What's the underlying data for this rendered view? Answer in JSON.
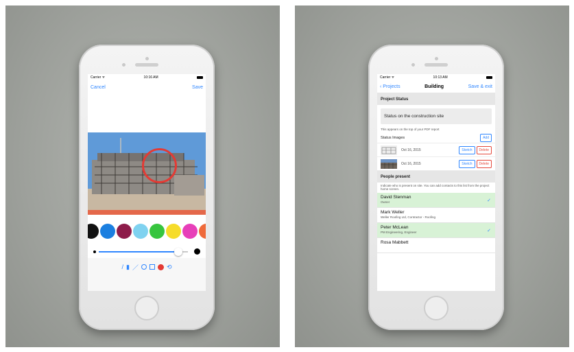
{
  "left": {
    "status_bar": {
      "carrier": "Carrier ᯤ",
      "time": "10:16 AM"
    },
    "nav": {
      "cancel": "Cancel",
      "save": "Save"
    },
    "palette_colors": [
      "#111111",
      "#1b7fe0",
      "#8e1c4a",
      "#7fd2f0",
      "#37c53f",
      "#f6dc2a",
      "#e73fb9",
      "#ef6a3a"
    ],
    "toolbar_icons": [
      "brush-icon",
      "marker-icon",
      "line-icon",
      "circle-icon",
      "rectangle-icon",
      "color-icon",
      "undo-icon"
    ]
  },
  "right": {
    "status_bar": {
      "carrier": "Carrier ᯤ",
      "time": "10:13 AM"
    },
    "nav": {
      "back": "Projects",
      "title": "Building",
      "save_exit": "Save & exit"
    },
    "project_status": {
      "header": "Project Status",
      "value": "Status on the construction site",
      "hint": "This appears on the top of your PDF report"
    },
    "status_images": {
      "label": "Status Images",
      "add": "Add",
      "items": [
        {
          "date": "Oct 16, 2015",
          "sketch": "Sketch",
          "delete": "Delete"
        },
        {
          "date": "Oct 16, 2015",
          "sketch": "Sketch",
          "delete": "Delete"
        }
      ]
    },
    "people": {
      "header": "People present",
      "hint": "Indicate who is present on site. You can add contacts to this list from the project home screen.",
      "items": [
        {
          "name": "David Stenman",
          "role": "Owner",
          "selected": true
        },
        {
          "name": "Mark Weller",
          "role": "Weller Roofing Ltd, Contractor - Roofing",
          "selected": false
        },
        {
          "name": "Peter McLean",
          "role": "PM Engineering, Engineer",
          "selected": true
        },
        {
          "name": "Rosa Mabbett",
          "role": "",
          "selected": false
        }
      ],
      "check": "✓"
    }
  }
}
